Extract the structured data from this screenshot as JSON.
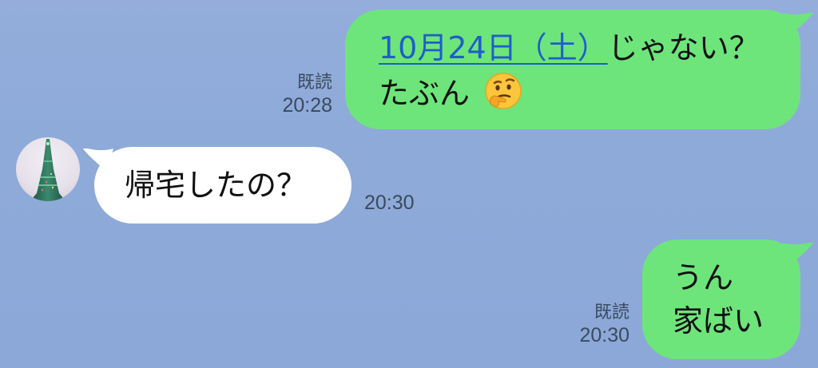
{
  "messages": [
    {
      "direction": "outgoing",
      "line1_link": "10月24日（土）",
      "line1_rest": "じゃない？",
      "line2": "たぶん",
      "emoji": "thinking-face-icon",
      "read": "既読",
      "time": "20:28"
    },
    {
      "direction": "incoming",
      "text": "帰宅したの？",
      "time": "20:30",
      "avatar": "tower-avatar"
    },
    {
      "direction": "outgoing",
      "line1": "うん",
      "line2": "家ばい",
      "read": "既読",
      "time": "20:30"
    }
  ],
  "colors": {
    "background": "#8eaada",
    "outgoing_bubble": "#6de57b",
    "incoming_bubble": "#ffffff",
    "link": "#1f5ec8",
    "meta_text": "#3b4a5e"
  }
}
